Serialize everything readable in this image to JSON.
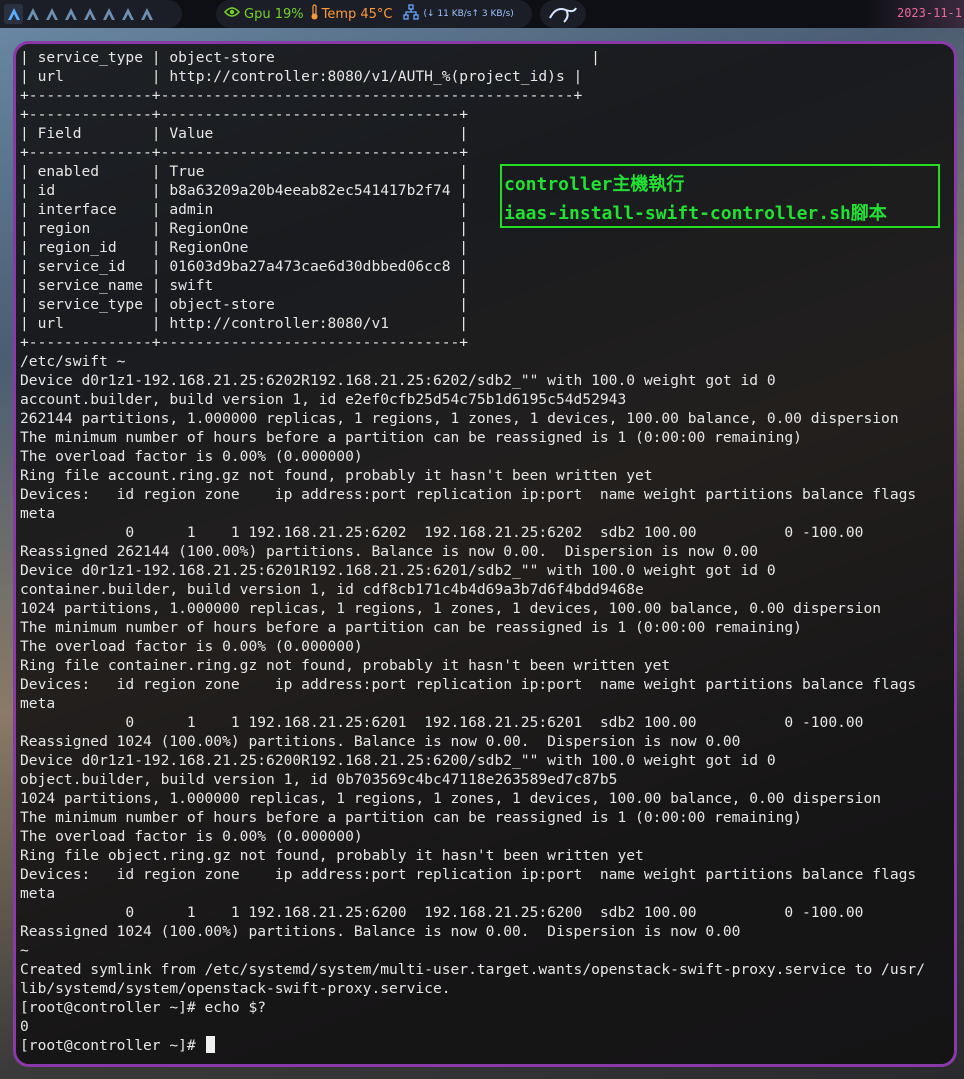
{
  "topbar": {
    "workspaces": [
      {
        "id": "ws1",
        "active": true
      },
      {
        "id": "ws2",
        "active": false
      },
      {
        "id": "ws3",
        "active": false
      },
      {
        "id": "ws4",
        "active": false
      },
      {
        "id": "ws5",
        "active": false
      },
      {
        "id": "ws6",
        "active": false
      },
      {
        "id": "ws7",
        "active": false
      },
      {
        "id": "ws8",
        "active": false
      }
    ],
    "gpu_label": "Gpu 19%",
    "temp_label": "Temp 45°C",
    "net_rate": "(↓ 11 KB/s↑ 3 KB/s)",
    "clock": "2023-11-1",
    "icons": {
      "gpu": "nvidia-icon",
      "temp": "thermometer-icon",
      "net": "network-icon",
      "launcher": "kali-dragon-icon"
    },
    "colors": {
      "gpu": "#76d12a",
      "temp": "#ff9a3c",
      "net": "#6aa6ff",
      "clock": "#e86a9a",
      "border": "#8a3aa8"
    }
  },
  "annotation": {
    "line1": "controller主機執行",
    "line2": "iaas-install-swift-controller.sh腳本",
    "color": "#22e033"
  },
  "terminal": {
    "lines": [
      "| service_type | object-store                                    |",
      "| url          | http://controller:8080/v1/AUTH_%(project_id)s |",
      "+--------------+-----------------------------------------------+",
      "+--------------+----------------------------------+",
      "| Field        | Value                            |",
      "+--------------+----------------------------------+",
      "| enabled      | True                             |",
      "| id           | b8a63209a20b4eeab82ec541417b2f74 |",
      "| interface    | admin                            |",
      "| region       | RegionOne                        |",
      "| region_id    | RegionOne                        |",
      "| service_id   | 01603d9ba27a473cae6d30dbbed06cc8 |",
      "| service_name | swift                            |",
      "| service_type | object-store                     |",
      "| url          | http://controller:8080/v1        |",
      "+--------------+----------------------------------+",
      "/etc/swift ~",
      "Device d0r1z1-192.168.21.25:6202R192.168.21.25:6202/sdb2_\"\" with 100.0 weight got id 0",
      "account.builder, build version 1, id e2ef0cfb25d54c75b1d6195c54d52943",
      "262144 partitions, 1.000000 replicas, 1 regions, 1 zones, 1 devices, 100.00 balance, 0.00 dispersion",
      "The minimum number of hours before a partition can be reassigned is 1 (0:00:00 remaining)",
      "The overload factor is 0.00% (0.000000)",
      "Ring file account.ring.gz not found, probably it hasn't been written yet",
      "Devices:   id region zone    ip address:port replication ip:port  name weight partitions balance flags",
      "meta",
      "            0      1    1 192.168.21.25:6202  192.168.21.25:6202  sdb2 100.00          0 -100.00",
      "Reassigned 262144 (100.00%) partitions. Balance is now 0.00.  Dispersion is now 0.00",
      "Device d0r1z1-192.168.21.25:6201R192.168.21.25:6201/sdb2_\"\" with 100.0 weight got id 0",
      "container.builder, build version 1, id cdf8cb171c4b4d69a3b7d6f4bdd9468e",
      "1024 partitions, 1.000000 replicas, 1 regions, 1 zones, 1 devices, 100.00 balance, 0.00 dispersion",
      "The minimum number of hours before a partition can be reassigned is 1 (0:00:00 remaining)",
      "The overload factor is 0.00% (0.000000)",
      "Ring file container.ring.gz not found, probably it hasn't been written yet",
      "Devices:   id region zone    ip address:port replication ip:port  name weight partitions balance flags",
      "meta",
      "            0      1    1 192.168.21.25:6201  192.168.21.25:6201  sdb2 100.00          0 -100.00",
      "Reassigned 1024 (100.00%) partitions. Balance is now 0.00.  Dispersion is now 0.00",
      "Device d0r1z1-192.168.21.25:6200R192.168.21.25:6200/sdb2_\"\" with 100.0 weight got id 0",
      "object.builder, build version 1, id 0b703569c4bc47118e263589ed7c87b5",
      "1024 partitions, 1.000000 replicas, 1 regions, 1 zones, 1 devices, 100.00 balance, 0.00 dispersion",
      "The minimum number of hours before a partition can be reassigned is 1 (0:00:00 remaining)",
      "The overload factor is 0.00% (0.000000)",
      "Ring file object.ring.gz not found, probably it hasn't been written yet",
      "Devices:   id region zone    ip address:port replication ip:port  name weight partitions balance flags",
      "meta",
      "            0      1    1 192.168.21.25:6200  192.168.21.25:6200  sdb2 100.00          0 -100.00",
      "Reassigned 1024 (100.00%) partitions. Balance is now 0.00.  Dispersion is now 0.00",
      "~",
      "Created symlink from /etc/systemd/system/multi-user.target.wants/openstack-swift-proxy.service to /usr/",
      "lib/systemd/system/openstack-swift-proxy.service.",
      "[root@controller ~]# echo $?",
      "0"
    ],
    "prompt": "[root@controller ~]# "
  }
}
